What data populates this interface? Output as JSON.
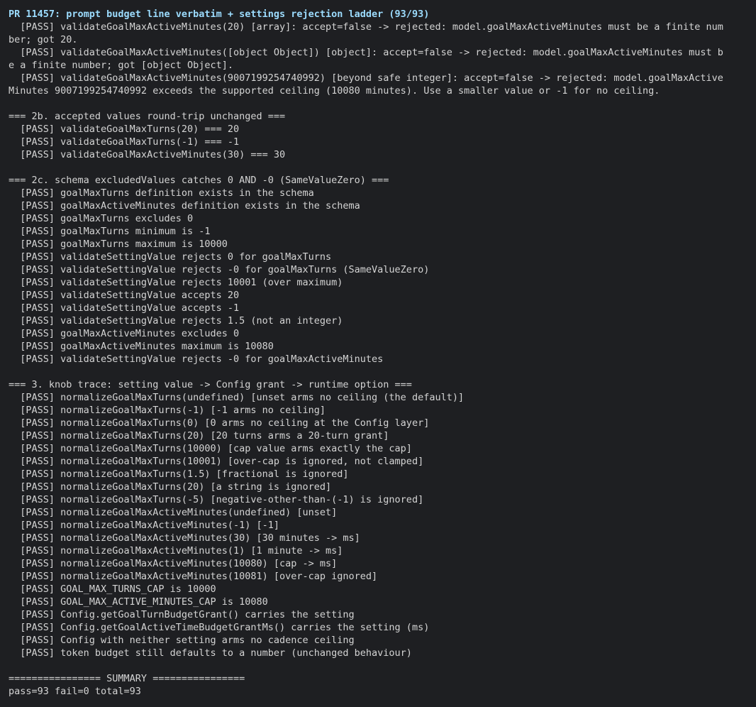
{
  "terminal": {
    "title": "PR 11457: prompt budget line verbatim + settings rejection ladder (93/93)",
    "lines": [
      "  [PASS] validateGoalMaxActiveMinutes(20) [array]: accept=false -> rejected: model.goalMaxActiveMinutes must be a finite num",
      "ber; got 20.",
      "  [PASS] validateGoalMaxActiveMinutes([object Object]) [object]: accept=false -> rejected: model.goalMaxActiveMinutes must b",
      "e a finite number; got [object Object].",
      "  [PASS] validateGoalMaxActiveMinutes(9007199254740992) [beyond safe integer]: accept=false -> rejected: model.goalMaxActive",
      "Minutes 9007199254740992 exceeds the supported ceiling (10080 minutes). Use a smaller value or -1 for no ceiling.",
      "",
      "=== 2b. accepted values round-trip unchanged ===",
      "  [PASS] validateGoalMaxTurns(20) === 20",
      "  [PASS] validateGoalMaxTurns(-1) === -1",
      "  [PASS] validateGoalMaxActiveMinutes(30) === 30",
      "",
      "=== 2c. schema excludedValues catches 0 AND -0 (SameValueZero) ===",
      "  [PASS] goalMaxTurns definition exists in the schema",
      "  [PASS] goalMaxActiveMinutes definition exists in the schema",
      "  [PASS] goalMaxTurns excludes 0",
      "  [PASS] goalMaxTurns minimum is -1",
      "  [PASS] goalMaxTurns maximum is 10000",
      "  [PASS] validateSettingValue rejects 0 for goalMaxTurns",
      "  [PASS] validateSettingValue rejects -0 for goalMaxTurns (SameValueZero)",
      "  [PASS] validateSettingValue rejects 10001 (over maximum)",
      "  [PASS] validateSettingValue accepts 20",
      "  [PASS] validateSettingValue accepts -1",
      "  [PASS] validateSettingValue rejects 1.5 (not an integer)",
      "  [PASS] goalMaxActiveMinutes excludes 0",
      "  [PASS] goalMaxActiveMinutes maximum is 10080",
      "  [PASS] validateSettingValue rejects -0 for goalMaxActiveMinutes",
      "",
      "=== 3. knob trace: setting value -> Config grant -> runtime option ===",
      "  [PASS] normalizeGoalMaxTurns(undefined) [unset arms no ceiling (the default)]",
      "  [PASS] normalizeGoalMaxTurns(-1) [-1 arms no ceiling]",
      "  [PASS] normalizeGoalMaxTurns(0) [0 arms no ceiling at the Config layer]",
      "  [PASS] normalizeGoalMaxTurns(20) [20 turns arms a 20-turn grant]",
      "  [PASS] normalizeGoalMaxTurns(10000) [cap value arms exactly the cap]",
      "  [PASS] normalizeGoalMaxTurns(10001) [over-cap is ignored, not clamped]",
      "  [PASS] normalizeGoalMaxTurns(1.5) [fractional is ignored]",
      "  [PASS] normalizeGoalMaxTurns(20) [a string is ignored]",
      "  [PASS] normalizeGoalMaxTurns(-5) [negative-other-than-(-1) is ignored]",
      "  [PASS] normalizeGoalMaxActiveMinutes(undefined) [unset]",
      "  [PASS] normalizeGoalMaxActiveMinutes(-1) [-1]",
      "  [PASS] normalizeGoalMaxActiveMinutes(30) [30 minutes -> ms]",
      "  [PASS] normalizeGoalMaxActiveMinutes(1) [1 minute -> ms]",
      "  [PASS] normalizeGoalMaxActiveMinutes(10080) [cap -> ms]",
      "  [PASS] normalizeGoalMaxActiveMinutes(10081) [over-cap ignored]",
      "  [PASS] GOAL_MAX_TURNS_CAP is 10000",
      "  [PASS] GOAL_MAX_ACTIVE_MINUTES_CAP is 10080",
      "  [PASS] Config.getGoalTurnBudgetGrant() carries the setting",
      "  [PASS] Config.getGoalActiveTimeBudgetGrantMs() carries the setting (ms)",
      "  [PASS] Config with neither setting arms no cadence ceiling",
      "  [PASS] token budget still defaults to a number (unchanged behaviour)",
      "",
      "================ SUMMARY ================",
      "pass=93 fail=0 total=93"
    ]
  }
}
